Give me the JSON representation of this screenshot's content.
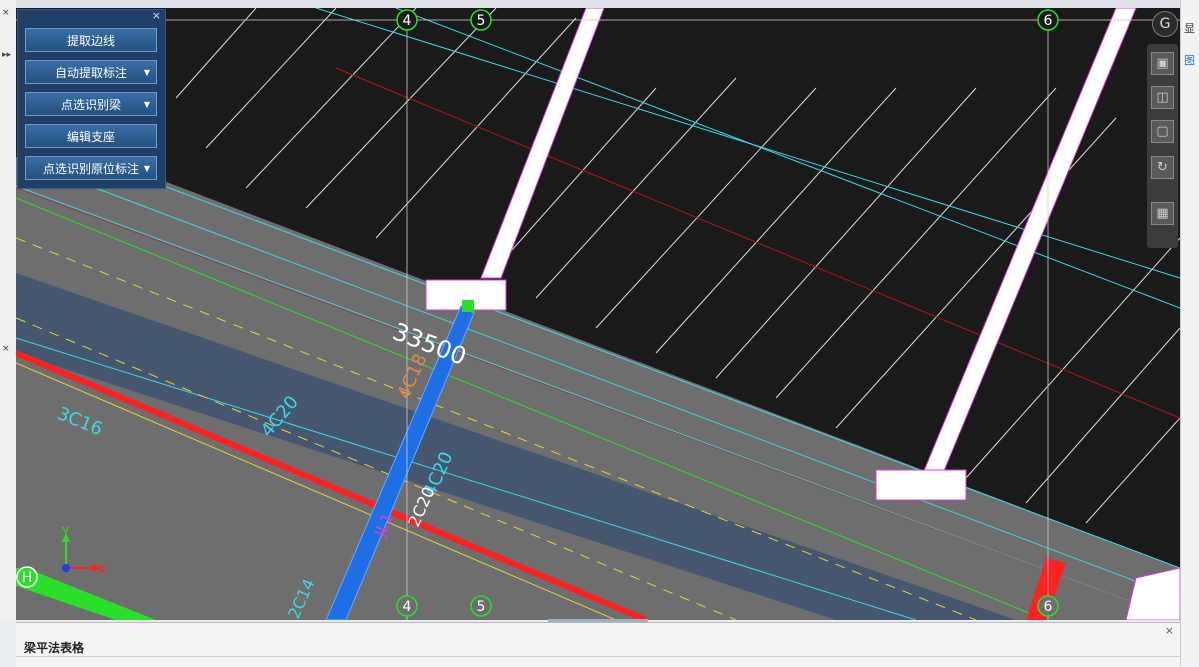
{
  "tool_panel": {
    "close_glyph": "×",
    "buttons": [
      {
        "label": "提取边线",
        "dropdown": false
      },
      {
        "label": "自动提取标注",
        "dropdown": true
      },
      {
        "label": "点选识别梁",
        "dropdown": true
      },
      {
        "label": "编辑支座",
        "dropdown": false
      },
      {
        "label": "点选识别原位标注",
        "dropdown": true
      }
    ],
    "dropdown_glyph": "▼"
  },
  "axes": {
    "top": [
      "4",
      "5",
      "6"
    ],
    "bottom": [
      "4",
      "5",
      "6"
    ],
    "left": [
      "H"
    ]
  },
  "annotations": {
    "dimension": "33500",
    "beam_rebar_1": "4C18",
    "beam_rebar_2": "4C20",
    "beam_rebar_3": "4C20",
    "beam_rebar_4": "3C16",
    "beam_rebar_5": "2C14",
    "beam_rebar_6": "2C20",
    "span_label": "JL1"
  },
  "ucs": {
    "x_label": "X",
    "y_label": "Y"
  },
  "view_cube": {
    "label": "G"
  },
  "view_toolbar": {
    "buttons": [
      "top-view",
      "iso-view",
      "box-view",
      "rotate",
      "grid-view"
    ]
  },
  "bottom_panel": {
    "title": "梁平法表格",
    "close_glyph": "×"
  },
  "right_strip": {
    "labels": [
      "显",
      "图"
    ]
  },
  "left_strip": {
    "marks": [
      "×",
      "▸▸",
      "×"
    ]
  },
  "colors": {
    "canvas_bg": "#1a1a1a",
    "slab_fill": "#6e6e6e",
    "beam_blue": "#1e6fe6",
    "red_beam": "#ff2020",
    "cyan": "#3fd6e6",
    "magenta": "#d63fd6",
    "yellow": "#e6d23f",
    "green": "#2adf2a"
  }
}
